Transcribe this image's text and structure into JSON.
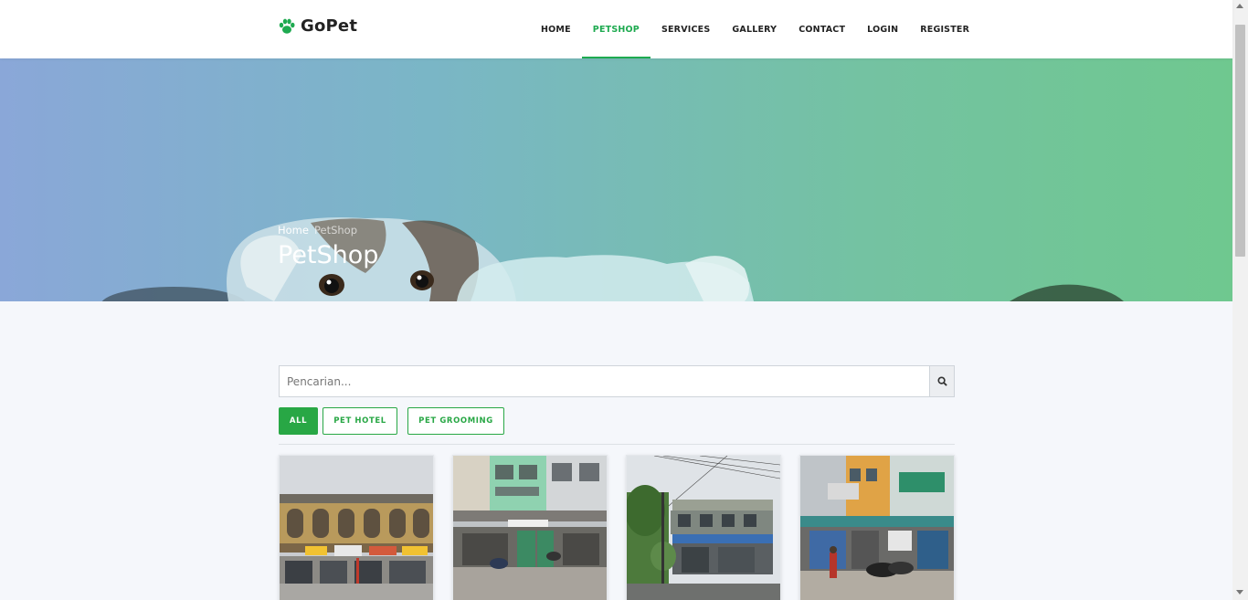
{
  "brand": {
    "name": "GoPet",
    "logo_icon": "paw-icon",
    "accent": "#1eaa50"
  },
  "nav": {
    "items": [
      {
        "label": "HOME",
        "active": false
      },
      {
        "label": "PETSHOP",
        "active": true
      },
      {
        "label": "SERVICES",
        "active": false
      },
      {
        "label": "GALLERY",
        "active": false
      },
      {
        "label": "CONTACT",
        "active": false
      },
      {
        "label": "LOGIN",
        "active": false
      },
      {
        "label": "REGISTER",
        "active": false
      }
    ]
  },
  "hero": {
    "breadcrumb": {
      "home": "Home",
      "current": "PetShop"
    },
    "title": "PetShop"
  },
  "search": {
    "placeholder": "Pencarian...",
    "value": "",
    "button_icon": "search-icon"
  },
  "filters": [
    {
      "label": "ALL",
      "active": true
    },
    {
      "label": "PET HOTEL",
      "active": false
    },
    {
      "label": "PET GROOMING",
      "active": false
    }
  ],
  "cards": [
    {
      "image": "petshop-building-1"
    },
    {
      "image": "petshop-building-2"
    },
    {
      "image": "petshop-building-3"
    },
    {
      "image": "petshop-building-4"
    }
  ]
}
